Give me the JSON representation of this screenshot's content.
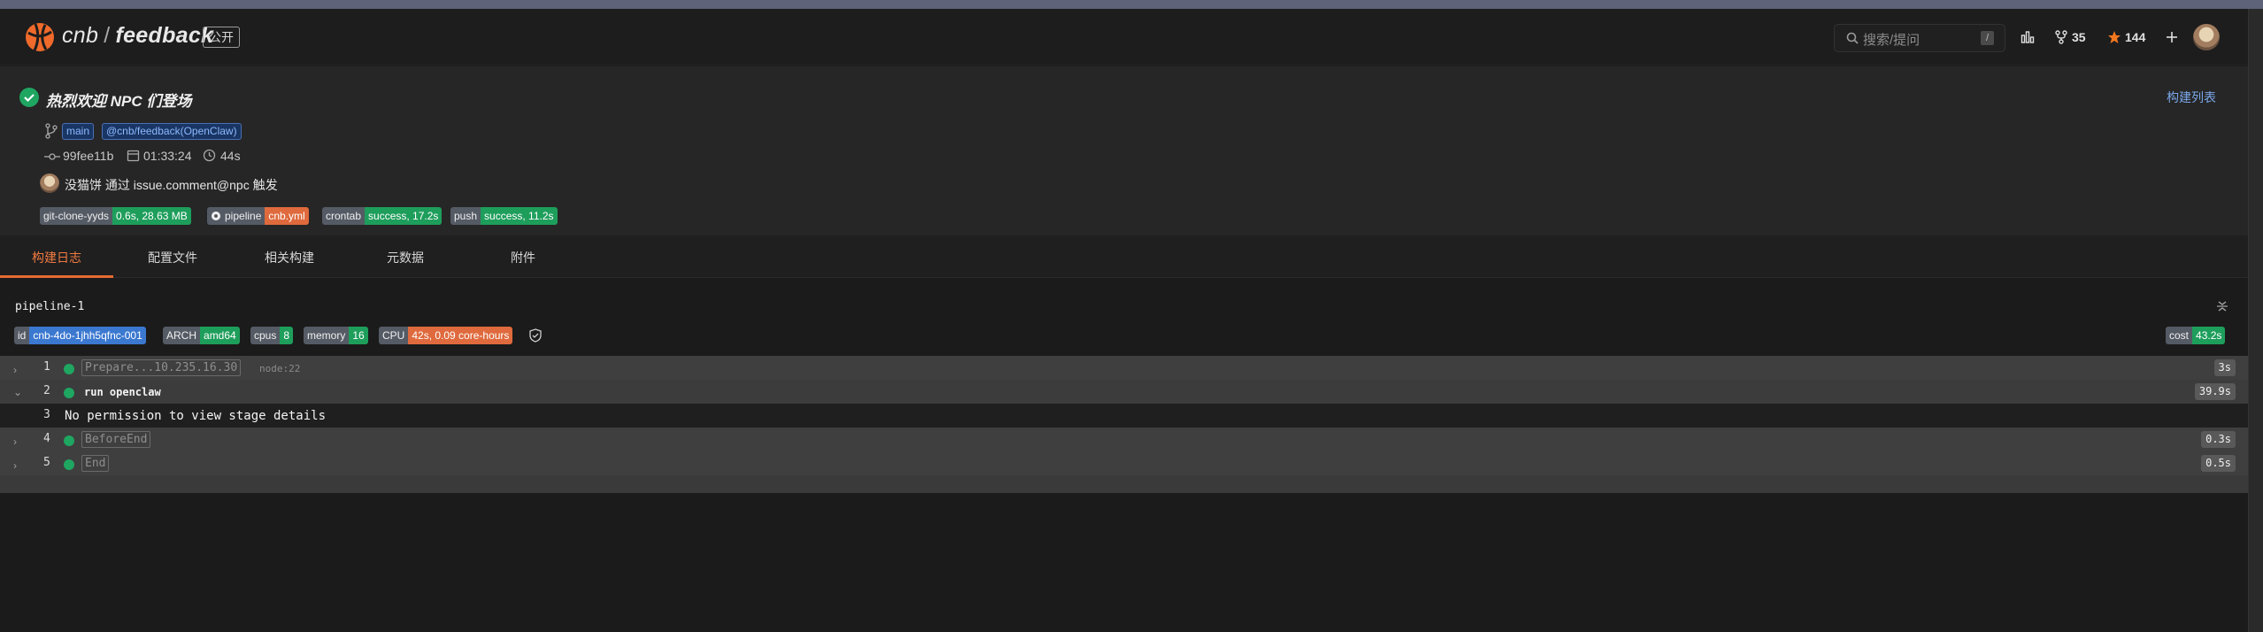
{
  "repo": {
    "owner": "cnb",
    "name": "feedback",
    "visibility": "公开"
  },
  "topbar": {
    "search_placeholder": "搜索/提问",
    "search_shortcut": "/",
    "fork_count": "35",
    "star_count": "144"
  },
  "build": {
    "title": "热烈欢迎 NPC 们登场",
    "list_link": "构建列表",
    "branch": "main",
    "ref": "@cnb/feedback(OpenClaw)",
    "commit": "99fee11b",
    "time": "01:33:24",
    "duration": "44s",
    "trigger_text": "没猫饼 通过 issue.comment@npc 触发",
    "badges": [
      {
        "k": "git-clone-yyds",
        "v": "0.6s, 28.63 MB"
      },
      {
        "k": "pipeline",
        "v": "cnb.yml"
      },
      {
        "k": "crontab",
        "v": "success, 17.2s"
      },
      {
        "k": "push",
        "v": "success, 11.2s"
      }
    ]
  },
  "tabs": [
    "构建日志",
    "配置文件",
    "相关构建",
    "元数据",
    "附件"
  ],
  "job": {
    "name": "pipeline-1",
    "badges": [
      {
        "k": "id",
        "v": "cnb-4do-1jhh5qfnc-001"
      },
      {
        "k": "ARCH",
        "v": "amd64"
      },
      {
        "k": "cpus",
        "v": "8"
      },
      {
        "k": "memory",
        "v": "16"
      },
      {
        "k": "CPU",
        "v": "42s, 0.09 core-hours"
      }
    ],
    "cost": {
      "k": "cost",
      "v": "43.2s"
    }
  },
  "log": [
    {
      "n": "1",
      "stage": "Prepare...10.235.16.30",
      "node": "node:22",
      "dur": "3s"
    },
    {
      "n": "2",
      "stage": "run openclaw",
      "dur": "39.9s"
    },
    {
      "n": "3",
      "message": "No permission to view stage details"
    },
    {
      "n": "4",
      "stage": "BeforeEnd",
      "dur": "0.3s"
    },
    {
      "n": "5",
      "stage": "End",
      "dur": "0.5s"
    }
  ]
}
